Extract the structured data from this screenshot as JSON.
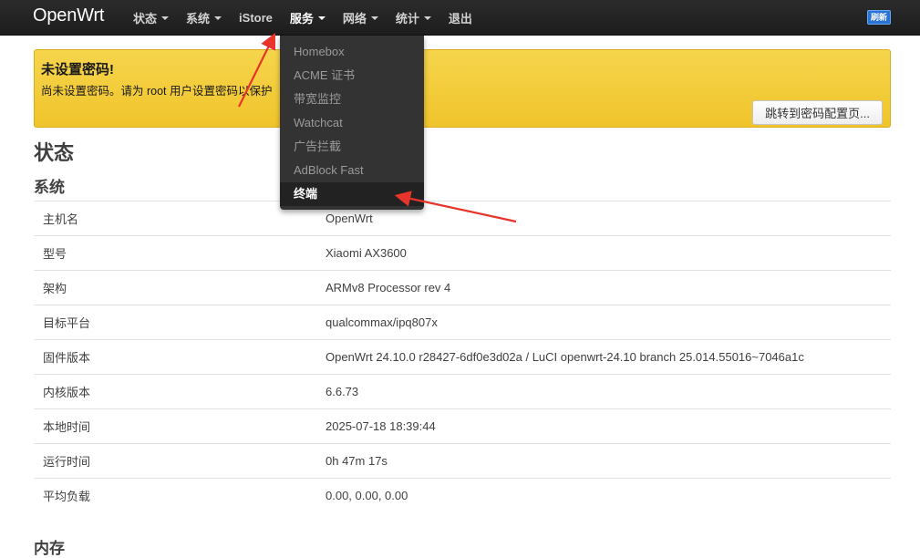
{
  "navbar": {
    "brand": "OpenWrt",
    "items": [
      {
        "label": "状态",
        "caret": true
      },
      {
        "label": "系统",
        "caret": true
      },
      {
        "label": "iStore",
        "caret": false
      },
      {
        "label": "服务",
        "caret": true
      },
      {
        "label": "网络",
        "caret": true
      },
      {
        "label": "统计",
        "caret": true
      },
      {
        "label": "退出",
        "caret": false
      }
    ],
    "refresh_badge": "刷新"
  },
  "alert": {
    "title": "未设置密码!",
    "text": "尚未设置密码。请为 root 用户设置密码以保护",
    "button_label": "跳转到密码配置页..."
  },
  "page": {
    "title": "状态",
    "system_heading": "系统",
    "memory_heading": "内存"
  },
  "system_info": [
    {
      "key": "主机名",
      "value": "OpenWrt"
    },
    {
      "key": "型号",
      "value": "Xiaomi AX3600"
    },
    {
      "key": "架构",
      "value": "ARMv8 Processor rev 4"
    },
    {
      "key": "目标平台",
      "value": "qualcommax/ipq807x"
    },
    {
      "key": "固件版本",
      "value": "OpenWrt 24.10.0 r28427-6df0e3d02a / LuCI openwrt-24.10 branch 25.014.55016~7046a1c"
    },
    {
      "key": "内核版本",
      "value": "6.6.73"
    },
    {
      "key": "本地时间",
      "value": "2025-07-18 18:39:44"
    },
    {
      "key": "运行时间",
      "value": "0h 47m 17s"
    },
    {
      "key": "平均负载",
      "value": "0.00, 0.00, 0.00"
    }
  ],
  "services_menu": {
    "items": [
      {
        "label": "Homebox",
        "highlighted": false
      },
      {
        "label": "ACME 证书",
        "highlighted": false
      },
      {
        "label": "带宽监控",
        "highlighted": false
      },
      {
        "label": "Watchcat",
        "highlighted": false
      },
      {
        "label": "广告拦截",
        "highlighted": false
      },
      {
        "label": "AdBlock Fast",
        "highlighted": false
      },
      {
        "label": "终端",
        "highlighted": true
      }
    ]
  },
  "colors": {
    "navbar_bg": "#222222",
    "alert_bg": "#f2c533",
    "dropdown_bg": "#333333",
    "annotation_arrow": "#e8342a",
    "refresh_badge": "#2a73d6"
  }
}
